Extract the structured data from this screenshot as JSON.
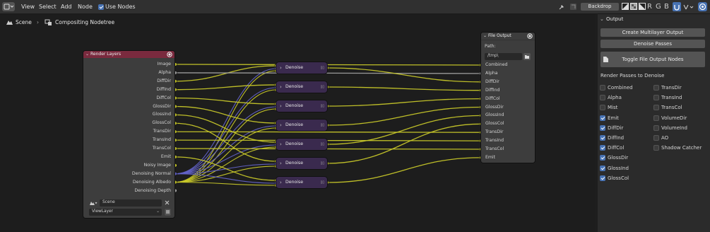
{
  "topbar": {
    "menus": [
      "View",
      "Select",
      "Add",
      "Node"
    ],
    "use_nodes_label": "Use Nodes",
    "use_nodes_checked": true,
    "backdrop_label": "Backdrop",
    "channel_r": "R",
    "channel_g": "G",
    "channel_b": "B"
  },
  "breadcrumb": {
    "scene": "Scene",
    "tree": "Compositing Nodetree"
  },
  "render_layers": {
    "title": "Render Layers",
    "outputs": [
      "Image",
      "Alpha",
      "DiffDir",
      "DiffInd",
      "DiffCol",
      "GlossDir",
      "GlossInd",
      "GlossCol",
      "TransDir",
      "TransInd",
      "TransCol",
      "Emit",
      "Noisy Image",
      "Denoising Normal",
      "Denoising Albedo",
      "Denoising Depth"
    ],
    "scene_value": "Scene",
    "view_layer_value": "ViewLayer"
  },
  "denoise_nodes": {
    "label": "Denoise",
    "count": 7
  },
  "file_output": {
    "title": "File Output",
    "path_label": "Path:",
    "path_value": "/tmp\\",
    "inputs": [
      "Combined",
      "Alpha",
      "DiffDir",
      "DiffInd",
      "DiffCol",
      "GlossDir",
      "GlossInd",
      "GlossCol",
      "TransDir",
      "TransInd",
      "TransCol",
      "Emit"
    ]
  },
  "sidebar": {
    "section_title": "Output",
    "create_multilayer_label": "Create Multilayer Output",
    "denoise_passes_label": "Denoise Passes",
    "toggle_file_output_label": "Toggle File Output Nodes",
    "passes_heading": "Render Passes to Denoise",
    "passes_left": [
      {
        "label": "Combined",
        "checked": false
      },
      {
        "label": "Alpha",
        "checked": false
      },
      {
        "label": "Mist",
        "checked": false
      },
      {
        "label": "Emit",
        "checked": true
      },
      {
        "label": "DiffDir",
        "checked": true
      },
      {
        "label": "DiffInd",
        "checked": true
      },
      {
        "label": "DiffCol",
        "checked": true
      },
      {
        "label": "GlossDir",
        "checked": true
      },
      {
        "label": "GlossInd",
        "checked": true
      },
      {
        "label": "GlossCol",
        "checked": true
      }
    ],
    "passes_right": [
      {
        "label": "TransDir",
        "checked": false
      },
      {
        "label": "TransInd",
        "checked": false
      },
      {
        "label": "TransCol",
        "checked": false
      },
      {
        "label": "VolumeDir",
        "checked": false
      },
      {
        "label": "VolumeInd",
        "checked": false
      },
      {
        "label": "AO",
        "checked": false
      },
      {
        "label": "Shadow Catcher",
        "checked": false
      }
    ]
  },
  "colors": {
    "color_socket": "#c7c729",
    "vector_socket": "#6363c7",
    "float_socket": "#a1a1a1",
    "render_layers_header": "#7a2a3e",
    "denoise_node": "#3a2a4e",
    "accent": "#4772b3"
  }
}
